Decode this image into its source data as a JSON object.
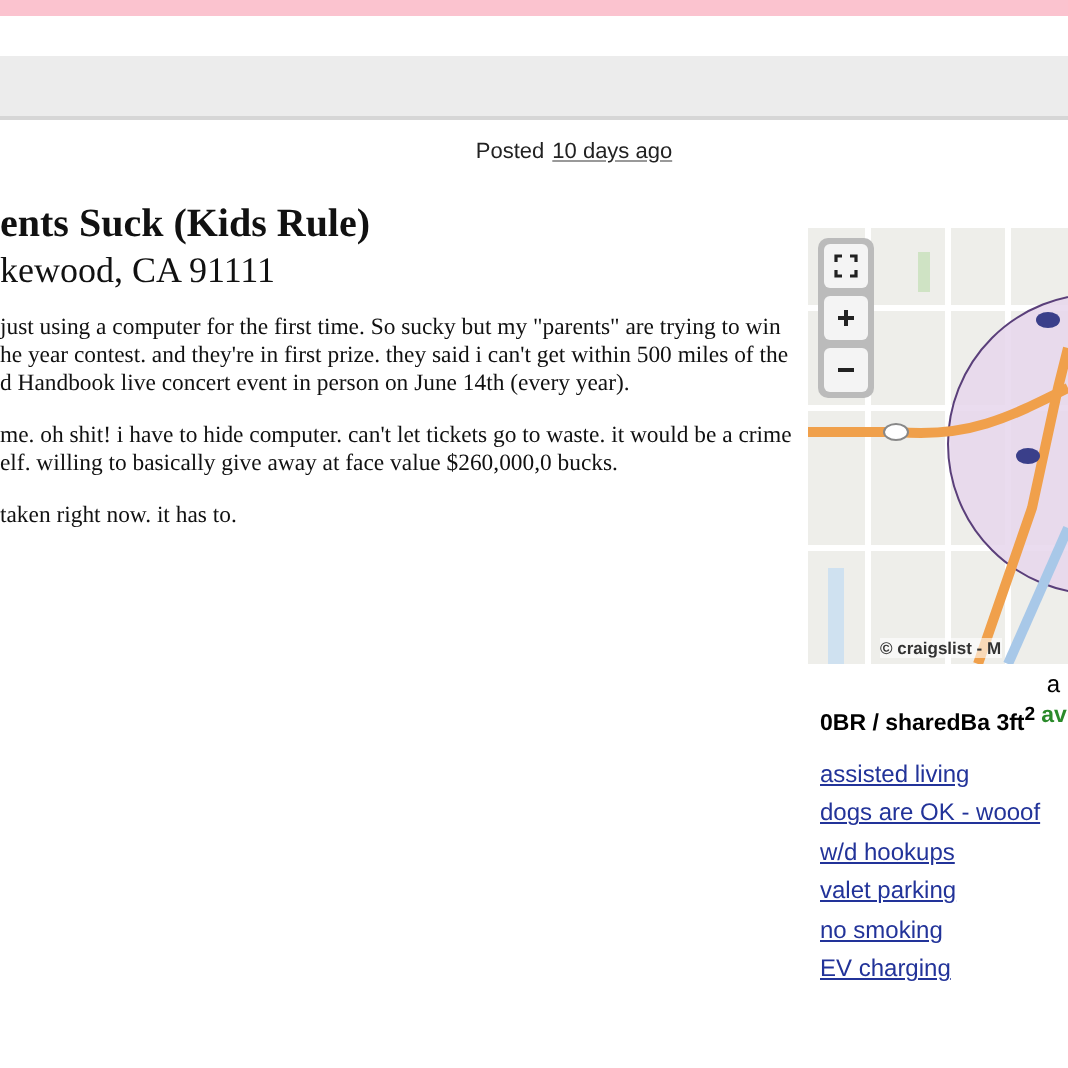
{
  "posting_info": {
    "label": "Posted",
    "time_link": "10 days ago"
  },
  "posting": {
    "title": "ents Suck (Kids Rule)",
    "location": "kewood, CA 91111",
    "paragraphs": [
      [
        "just using a computer for the first time. So sucky but my \"parents\" are trying to win",
        "he year contest. and they're in first prize. they said i can't get within 500 miles of the",
        "d Handbook live concert event in person on June 14th (every year)."
      ],
      [
        "me. oh shit! i have to hide computer. can't let tickets go to waste. it would be a crime",
        "elf. willing to basically give away at face value $260,000,0 bucks."
      ],
      [
        "taken right now. it has to."
      ]
    ]
  },
  "map": {
    "controls": [
      {
        "kind": "fullscreen"
      },
      {
        "kind": "zoom_in"
      },
      {
        "kind": "zoom_out"
      }
    ],
    "attribution": "© craigslist - M"
  },
  "sidebar": {
    "cut_text": "a",
    "attributes": "0BR / sharedBa 3ft$^{2}$",
    "availability": "av",
    "features": [
      "assisted living",
      "dogs are OK - wooof",
      "w/d hookups",
      "valet parking",
      "no smoking",
      "EV charging"
    ]
  }
}
